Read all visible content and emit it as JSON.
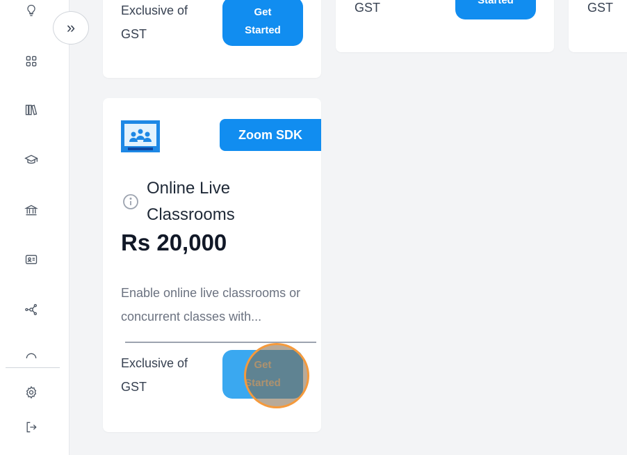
{
  "sidebar": {
    "icons": [
      "lightbulb-icon",
      "grid-icon",
      "library-icon",
      "graduation-cap-icon",
      "institution-icon",
      "id-card-icon",
      "network-icon",
      "partial-icon"
    ],
    "bottom": [
      "settings-icon",
      "logout-icon"
    ],
    "toggle_label": "»"
  },
  "top_cards": [
    {
      "gst_label": "Exclusive of\nGST",
      "button_label": "Get\nStarted"
    },
    {
      "gst_label": "GST",
      "button_label": "Started"
    },
    {
      "gst_label": "GST"
    }
  ],
  "product": {
    "badge": "Zoom SDK",
    "title": "Online Live Classrooms",
    "price": "Rs 20,000",
    "description": "Enable online live classrooms or concurrent classes with...",
    "gst_label": "Exclusive of\nGST",
    "button_label": "Get\nStarted"
  },
  "colors": {
    "accent": "#118df0",
    "click_ring": "#f59a3c"
  }
}
